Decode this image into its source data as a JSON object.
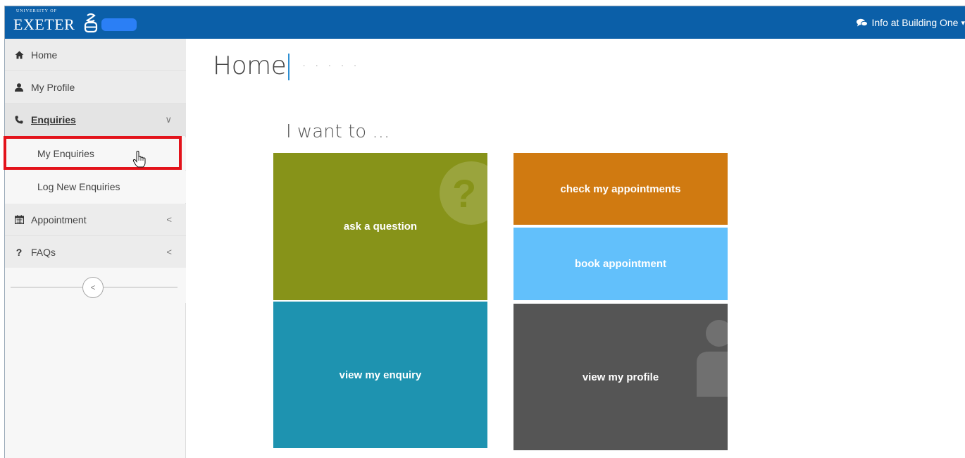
{
  "header": {
    "logo_univ": "UNIVERSITY OF",
    "logo_name": "EXETER",
    "info_text": "Info at Building One",
    "info_icon": "chat-icon",
    "info_caret": "▾",
    "bar_color": "#0b5fa8"
  },
  "sidebar": {
    "items": [
      {
        "label": "Home",
        "icon": "home-icon"
      },
      {
        "label": "My Profile",
        "icon": "user-icon"
      },
      {
        "label": "Enquiries",
        "icon": "phone-icon",
        "arrow": "∨",
        "active": true
      },
      {
        "label": "My Enquiries"
      },
      {
        "label": "Log New Enquiries",
        "highlighted": true
      },
      {
        "label": "Appointment",
        "icon": "calendar-icon",
        "arrow": "<"
      },
      {
        "label": "FAQs",
        "icon": "question-icon",
        "arrow": "<"
      }
    ],
    "collapse_glyph": "<"
  },
  "main": {
    "title": "Home",
    "title_suffix": "· · · · ·",
    "heading": "I want to ...",
    "tiles": [
      {
        "label": "ask a question",
        "color": "#879319",
        "watermark": "question-circle-icon",
        "watermark_glyph": "?"
      },
      {
        "label": "view my enquiry",
        "color": "#1e93b0"
      },
      {
        "label": "check my appointments",
        "color": "#d07a11"
      },
      {
        "label": "book appointment",
        "color": "#62c0fb"
      },
      {
        "label": "view my profile",
        "color": "#555555",
        "watermark": "person-icon"
      }
    ]
  },
  "colors": {
    "highlight": "#e3131b",
    "accent_separator": "#2e8fd2"
  }
}
